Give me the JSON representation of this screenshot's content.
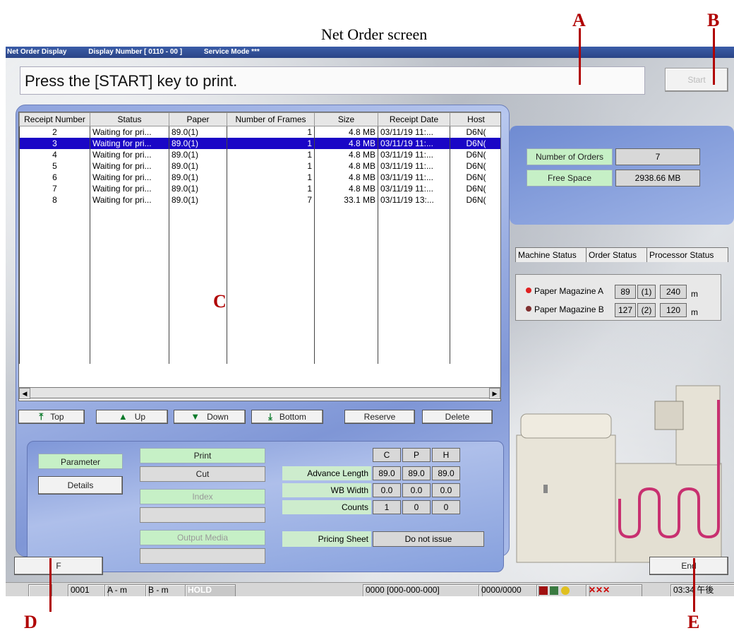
{
  "caption": "Net Order screen",
  "callouts": {
    "a": "A",
    "b": "B",
    "c": "C",
    "d": "D",
    "e": "E"
  },
  "titlebar": {
    "app": "Net Order Display",
    "display_number": "Display Number [ 0110 - 00 ]",
    "service_mode": "Service Mode  ***"
  },
  "message": "Press the [START] key to print.",
  "start_button": "Start",
  "table": {
    "columns": [
      "Receipt Number",
      "Status",
      "Paper",
      "Number of Frames",
      "Size",
      "Receipt Date",
      "Host"
    ],
    "rows": [
      [
        "2",
        "Waiting for pri...",
        "89.0(1)",
        "1",
        "4.8 MB",
        "03/11/19 11:...",
        "D6N("
      ],
      [
        "3",
        "Waiting for pri...",
        "89.0(1)",
        "1",
        "4.8 MB",
        "03/11/19 11:...",
        "D6N("
      ],
      [
        "4",
        "Waiting for pri...",
        "89.0(1)",
        "1",
        "4.8 MB",
        "03/11/19 11:...",
        "D6N("
      ],
      [
        "5",
        "Waiting for pri...",
        "89.0(1)",
        "1",
        "4.8 MB",
        "03/11/19 11:...",
        "D6N("
      ],
      [
        "6",
        "Waiting for pri...",
        "89.0(1)",
        "1",
        "4.8 MB",
        "03/11/19 11:...",
        "D6N("
      ],
      [
        "7",
        "Waiting for pri...",
        "89.0(1)",
        "1",
        "4.8 MB",
        "03/11/19 11:...",
        "D6N("
      ],
      [
        "8",
        "Waiting for pri...",
        "89.0(1)",
        "7",
        "33.1 MB",
        "03/11/19 13:...",
        "D6N("
      ]
    ],
    "selected_index": 1
  },
  "nav": {
    "top": "Top",
    "up": "Up",
    "down": "Down",
    "bottom": "Bottom",
    "reserve": "Reserve",
    "delete": "Delete"
  },
  "orders": {
    "count_label": "Number of Orders",
    "count_value": "7",
    "space_label": "Free Space",
    "space_value": "2938.66 MB"
  },
  "tabs": [
    "Machine Status",
    "Order Status",
    "Processor Status"
  ],
  "magazines": [
    {
      "label": "Paper Magazine A",
      "width": "89",
      "slot": "(1)",
      "length": "240",
      "unit": "m",
      "indicator_color": "#e02020"
    },
    {
      "label": "Paper Magazine B",
      "width": "127",
      "slot": "(2)",
      "length": "120",
      "unit": "m",
      "indicator_color": "#803030"
    }
  ],
  "params": {
    "parameter_label": "Parameter",
    "details_button": "Details",
    "print": "Print",
    "cut": "Cut",
    "index": "Index",
    "index_value": "",
    "output_media": "Output Media",
    "output_media_value": "",
    "col_headers": [
      "C",
      "P",
      "H"
    ],
    "advance_length_label": "Advance Length",
    "advance_length": [
      "89.0",
      "89.0",
      "89.0"
    ],
    "wb_width_label": "WB Width",
    "wb_width": [
      "0.0",
      "0.0",
      "0.0"
    ],
    "counts_label": "Counts",
    "counts": [
      "1",
      "0",
      "0"
    ],
    "pricing_sheet_label": "Pricing Sheet",
    "pricing_sheet_value": "Do not issue"
  },
  "f_button": "F",
  "end_button": "End",
  "statusbar": {
    "counter": "0001",
    "a_seg": "A  - m",
    "b_seg": "B  - m",
    "hold": "HOLD",
    "code": "0000 [000-000-000]",
    "ratio": "0000/0000",
    "time": "03:34 午後"
  }
}
